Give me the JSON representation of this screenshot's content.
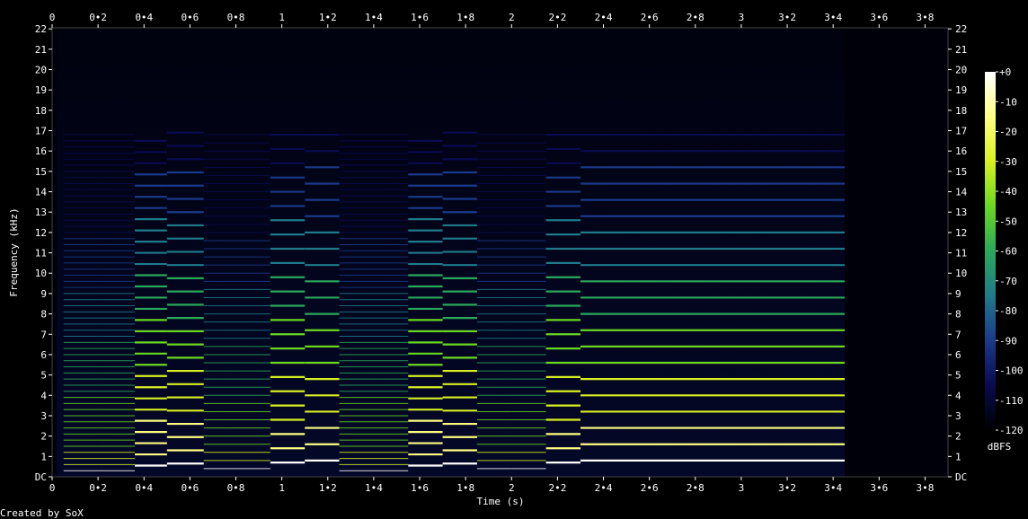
{
  "chart_data": {
    "type": "heatmap",
    "title": "",
    "xlabel": "Time (s)",
    "ylabel": "Frequency (kHz)",
    "x_ticks": [
      "0",
      "0•2",
      "0•4",
      "0•6",
      "0•8",
      "1",
      "1•2",
      "1•4",
      "1•6",
      "1•8",
      "2",
      "2•2",
      "2•4",
      "2•6",
      "2•8",
      "3",
      "3•2",
      "3•4",
      "3•6",
      "3•8"
    ],
    "x_tick_values": [
      0,
      0.2,
      0.4,
      0.6,
      0.8,
      1,
      1.2,
      1.4,
      1.6,
      1.8,
      2,
      2.2,
      2.4,
      2.6,
      2.8,
      3,
      3.2,
      3.4,
      3.6,
      3.8
    ],
    "y_ticks": [
      "DC",
      "1",
      "2",
      "3",
      "4",
      "5",
      "6",
      "7",
      "8",
      "9",
      "10",
      "11",
      "12",
      "13",
      "14",
      "15",
      "16",
      "17",
      "18",
      "19",
      "20",
      "21",
      "22"
    ],
    "y_tick_values": [
      0,
      1,
      2,
      3,
      4,
      5,
      6,
      7,
      8,
      9,
      10,
      11,
      12,
      13,
      14,
      15,
      16,
      17,
      18,
      19,
      20,
      21,
      22
    ],
    "xlim": [
      0,
      3.9
    ],
    "ylim": [
      0,
      22.05
    ],
    "colorbar": {
      "label": "dBFS",
      "ticks": [
        "+0",
        "-10",
        "-20",
        "-30",
        "-40",
        "-50",
        "-60",
        "-70",
        "-80",
        "-90",
        "-100",
        "-110",
        "-120"
      ],
      "tick_values": [
        0,
        -10,
        -20,
        -30,
        -40,
        -50,
        -60,
        -70,
        -80,
        -90,
        -100,
        -110,
        -120
      ],
      "range": [
        -120,
        0
      ]
    },
    "colormap": [
      "#000000",
      "#0a0a50",
      "#1a3a8a",
      "#1f7a8a",
      "#2aa85a",
      "#6ad820",
      "#d8f020",
      "#ffff80",
      "#ffffff"
    ],
    "notes_segments": [
      {
        "t0": 0.05,
        "t1": 0.2,
        "f0_khz": 0.3,
        "harmonics": "dense"
      },
      {
        "t0": 0.2,
        "t1": 0.36,
        "f0_khz": 0.3,
        "harmonics": "dense"
      },
      {
        "t0": 0.36,
        "t1": 0.5,
        "f0_khz": 0.55,
        "harmonics": "clear"
      },
      {
        "t0": 0.5,
        "t1": 0.66,
        "f0_khz": 0.65,
        "harmonics": "clear"
      },
      {
        "t0": 0.66,
        "t1": 0.8,
        "f0_khz": 0.4,
        "harmonics": "dense"
      },
      {
        "t0": 0.8,
        "t1": 0.95,
        "f0_khz": 0.4,
        "harmonics": "dense"
      },
      {
        "t0": 0.95,
        "t1": 1.1,
        "f0_khz": 0.7,
        "harmonics": "clear"
      },
      {
        "t0": 1.1,
        "t1": 1.25,
        "f0_khz": 0.8,
        "harmonics": "clear"
      },
      {
        "t0": 1.25,
        "t1": 1.55,
        "f0_khz": 0.3,
        "harmonics": "dense"
      },
      {
        "t0": 1.55,
        "t1": 1.7,
        "f0_khz": 0.55,
        "harmonics": "clear"
      },
      {
        "t0": 1.7,
        "t1": 1.85,
        "f0_khz": 0.65,
        "harmonics": "clear"
      },
      {
        "t0": 1.85,
        "t1": 2.0,
        "f0_khz": 0.4,
        "harmonics": "dense"
      },
      {
        "t0": 2.0,
        "t1": 2.15,
        "f0_khz": 0.4,
        "harmonics": "dense"
      },
      {
        "t0": 2.15,
        "t1": 2.3,
        "f0_khz": 0.7,
        "harmonics": "clear"
      },
      {
        "t0": 2.3,
        "t1": 3.45,
        "f0_khz": 0.8,
        "harmonics": "clear"
      }
    ]
  },
  "footer": "Created by SoX"
}
